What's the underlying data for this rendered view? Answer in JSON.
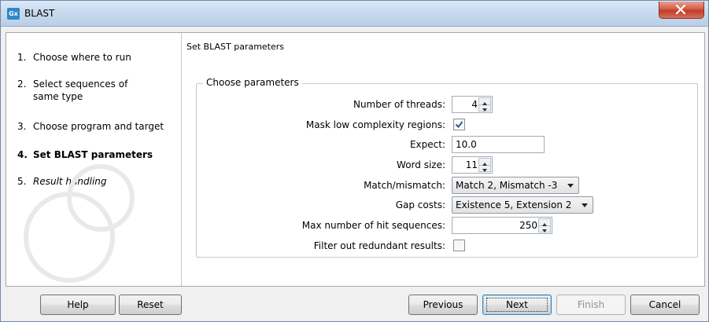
{
  "window": {
    "title": "BLAST",
    "app_icon_text": "Gx"
  },
  "steps": [
    {
      "num": "1.",
      "label": "Choose where to run",
      "state": "done"
    },
    {
      "num": "2.",
      "label": "Select sequences of same type",
      "state": "done"
    },
    {
      "num": "3.",
      "label": "Choose program and target",
      "state": "done"
    },
    {
      "num": "4.",
      "label": "Set BLAST parameters",
      "state": "active"
    },
    {
      "num": "5.",
      "label": "Result handling",
      "state": "future"
    }
  ],
  "panel": {
    "title": "Set BLAST parameters",
    "group_title": "Choose parameters",
    "threads": {
      "label": "Number of threads:",
      "value": "4"
    },
    "mask": {
      "label": "Mask low complexity regions:",
      "checked": true
    },
    "expect": {
      "label": "Expect:",
      "value": "10.0"
    },
    "word_size": {
      "label": "Word size:",
      "value": "11"
    },
    "match": {
      "label": "Match/mismatch:",
      "value": "Match 2, Mismatch -3"
    },
    "gap": {
      "label": "Gap costs:",
      "value": "Existence 5, Extension 2"
    },
    "max_hits": {
      "label": "Max number of hit sequences:",
      "value": "250"
    },
    "filter": {
      "label": "Filter out redundant results:",
      "checked": false
    }
  },
  "buttons": {
    "help": "Help",
    "reset": "Reset",
    "previous": "Previous",
    "next": "Next",
    "finish": "Finish",
    "cancel": "Cancel"
  },
  "colors": {
    "accent": "#2f86c9",
    "close": "#c94a35",
    "check": "#2a5b9a"
  }
}
